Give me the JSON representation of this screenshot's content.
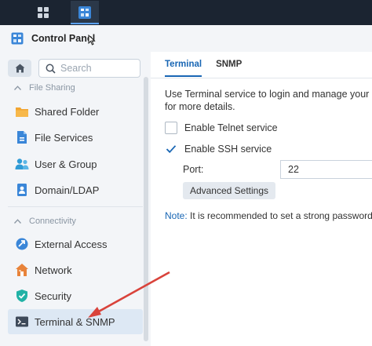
{
  "window": {
    "title": "Control Panel"
  },
  "search": {
    "placeholder": "Search"
  },
  "sidebar": {
    "sections": [
      {
        "label": "File Sharing"
      },
      {
        "label": "Connectivity"
      }
    ],
    "items": [
      {
        "label": "Shared Folder",
        "icon": "folder-icon"
      },
      {
        "label": "File Services",
        "icon": "file-services-icon"
      },
      {
        "label": "User & Group",
        "icon": "user-group-icon"
      },
      {
        "label": "Domain/LDAP",
        "icon": "domain-ldap-icon"
      },
      {
        "label": "External Access",
        "icon": "external-access-icon"
      },
      {
        "label": "Network",
        "icon": "network-icon"
      },
      {
        "label": "Security",
        "icon": "security-icon"
      },
      {
        "label": "Terminal & SNMP",
        "icon": "terminal-icon"
      }
    ]
  },
  "tabs": [
    {
      "label": "Terminal",
      "active": true
    },
    {
      "label": "SNMP",
      "active": false
    }
  ],
  "main": {
    "description_line1": "Use Terminal service to login and manage your sys",
    "description_line2": "for more details.",
    "telnet_label": "Enable Telnet service",
    "telnet_checked": false,
    "ssh_label": "Enable SSH service",
    "ssh_checked": true,
    "port_label": "Port:",
    "port_value": "22",
    "advanced_button": "Advanced Settings",
    "note_key": "Note:",
    "note_text": " It is recommended to set a strong password"
  },
  "colors": {
    "accent": "#1866b4",
    "annotation_arrow": "#d9433b",
    "taskbar": "#1b2431"
  }
}
